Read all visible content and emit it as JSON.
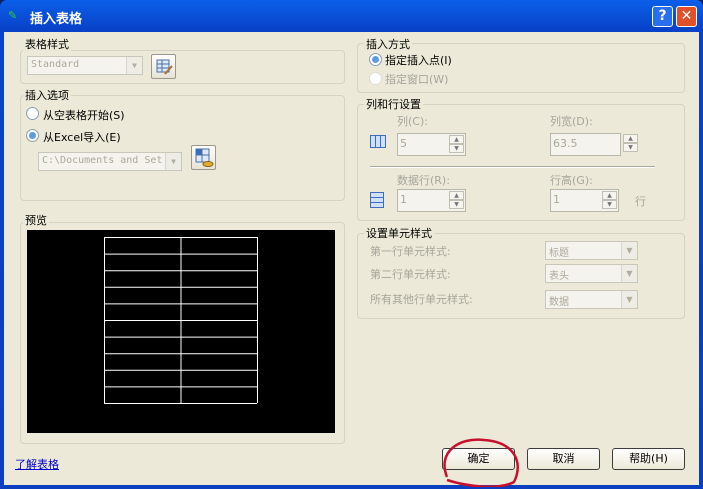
{
  "window": {
    "title": "插入表格",
    "help_btn": "?",
    "close_btn": "✕"
  },
  "table_style": {
    "label": "表格样式",
    "value": "Standard"
  },
  "insert_options": {
    "label": "插入选项",
    "opt_empty": "从空表格开始(S)",
    "opt_excel": "从Excel导入(E)",
    "path": "C:\\Documents and Set"
  },
  "preview": {
    "label": "预览",
    "rows": 10,
    "cols": 2
  },
  "insert_method": {
    "label": "插入方式",
    "opt_point": "指定插入点(I)",
    "opt_window": "指定窗口(W)"
  },
  "col_row": {
    "label": "列和行设置",
    "cols_label": "列(C):",
    "cols_value": "5",
    "colwidth_label": "列宽(D):",
    "colwidth_value": "63.5",
    "datarows_label": "数据行(R):",
    "datarows_value": "1",
    "rowheight_label": "行高(G):",
    "rowheight_value": "1",
    "row_unit": "行"
  },
  "cell_styles": {
    "label": "设置单元样式",
    "first_label": "第一行单元样式:",
    "first_value": "标题",
    "second_label": "第二行单元样式:",
    "second_value": "表头",
    "other_label": "所有其他行单元样式:",
    "other_value": "数据"
  },
  "footer": {
    "link": "了解表格",
    "ok": "确定",
    "cancel": "取消",
    "help": "帮助(H)"
  }
}
